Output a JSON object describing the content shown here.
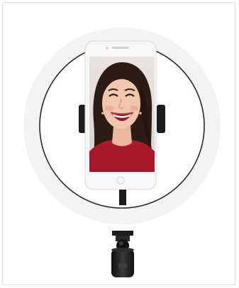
{
  "image": {
    "kind": "product-photo",
    "subject": "ring-light-with-phone-holder",
    "colors": {
      "background": "#ffffff",
      "ring_glow": "#f2f2f2",
      "ring_outline": "#2a2a2a",
      "phone_body": "#f7f7f7",
      "holder_black": "#1c1c1c",
      "sweater_red": "#a8182a",
      "hair_dark": "#2b1b14",
      "skin": "#f1c6ad"
    }
  }
}
